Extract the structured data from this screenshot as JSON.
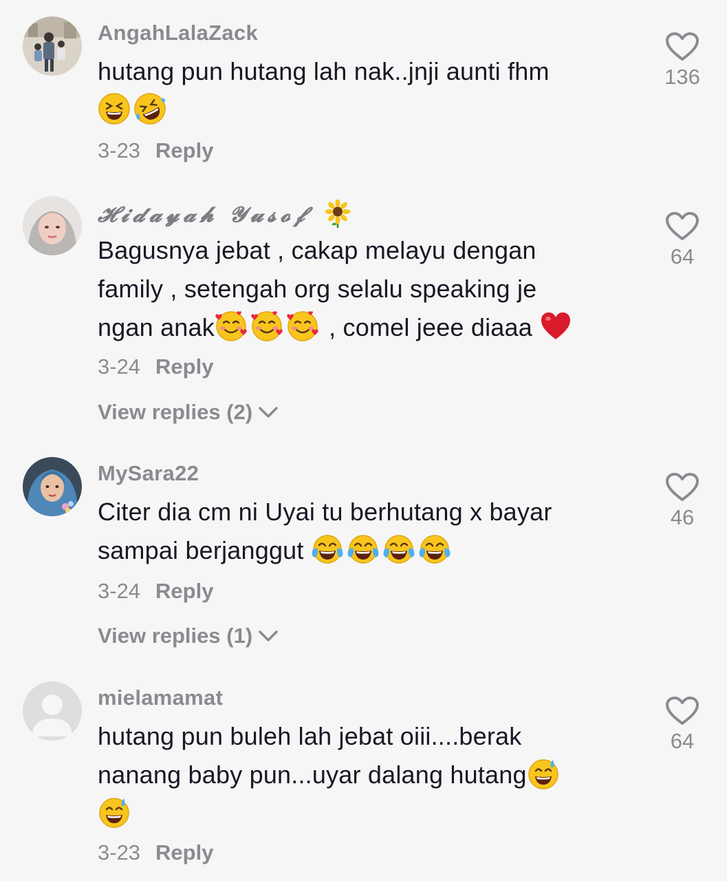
{
  "comments": [
    {
      "username": "AngahLalaZack",
      "text": "hutang pun hutang lah nak..jnji aunti fhm",
      "date": "3-23",
      "reply_label": "Reply",
      "likes": "136"
    },
    {
      "username": "𝓗𝓲𝓭𝓪𝔂𝓪𝓱 𝓨𝓾𝓼𝓸𝓯",
      "text_lines": [
        "Bagusnya jebat , cakap melayu dengan",
        "family , setengah org selalu speaking je",
        "ngan anak",
        " , comel jeee diaaa "
      ],
      "date": "3-24",
      "reply_label": "Reply",
      "likes": "64",
      "view_replies": "View replies (2)"
    },
    {
      "username": "MySara22",
      "text_lines": [
        "Citer dia cm ni Uyai tu berhutang x bayar",
        "sampai berjanggut "
      ],
      "date": "3-24",
      "reply_label": "Reply",
      "likes": "46",
      "view_replies": "View replies (1)"
    },
    {
      "username": "mielamamat",
      "text_lines": [
        "hutang pun buleh lah jebat oiii....berak",
        "nanang baby pun...uyar dalang hutang"
      ],
      "date": "3-23",
      "reply_label": "Reply",
      "likes": "64"
    }
  ],
  "icons": {
    "like": "heart-outline-icon",
    "expand": "chevron-down-icon"
  },
  "colors": {
    "background": "#f6f6f6",
    "text": "#161823",
    "muted": "#8a8b91"
  }
}
